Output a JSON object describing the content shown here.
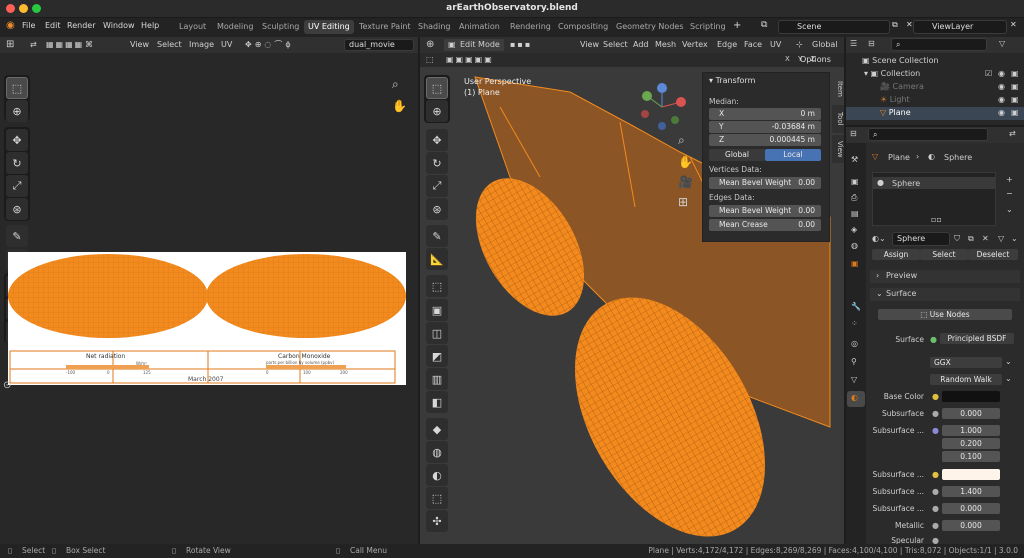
{
  "window": {
    "title": "arEarthObservatory.blend"
  },
  "menu": [
    "File",
    "Edit",
    "Render",
    "Window",
    "Help"
  ],
  "workspaces": [
    "Layout",
    "Modeling",
    "Sculpting",
    "UV Editing",
    "Texture Paint",
    "Shading",
    "Animation",
    "Rendering",
    "Compositing",
    "Geometry Nodes",
    "Scripting"
  ],
  "active_workspace": "UV Editing",
  "scene": "Scene",
  "view_layer": "ViewLayer",
  "uv_editor": {
    "menus": [
      "View",
      "Select",
      "Image",
      "UV"
    ],
    "image_name": "dual_movie",
    "texture_labels": {
      "left_title": "Net radiation",
      "right_title": "Carbon Monoxide",
      "right_subtitle": "parts per billion by volume (ppbv)",
      "left_units": "W/m²",
      "date": "March 2007",
      "left_ticks": [
        "-100",
        "0",
        "125"
      ],
      "right_ticks": [
        "0",
        "100",
        "200"
      ]
    }
  },
  "viewport": {
    "mode": "Edit Mode",
    "menus": [
      "View",
      "Select",
      "Add",
      "Mesh",
      "Vertex",
      "Edge",
      "Face",
      "UV"
    ],
    "orientation": "Global",
    "overlay_label": "User Perspective",
    "object_label": "(1) Plane",
    "options": "Options",
    "side_tabs": [
      "Item",
      "Tool",
      "View"
    ]
  },
  "transform_panel": {
    "title": "Transform",
    "median_label": "Median:",
    "x_label": "X",
    "x_value": "0 m",
    "y_label": "Y",
    "y_value": "-0.03684 m",
    "z_label": "Z",
    "z_value": "0.000445 m",
    "global": "Global",
    "local": "Local",
    "vertices_data": "Vertices Data:",
    "mean_bevel_weight": "Mean Bevel Weight",
    "mbw_v": "0.00",
    "edges_data": "Edges Data:",
    "mean_bevel_weight_e": "Mean Bevel Weight",
    "mbw_e": "0.00",
    "mean_crease": "Mean Crease",
    "mc": "0.00"
  },
  "outliner": {
    "root": "Scene Collection",
    "collection": "Collection",
    "items": [
      "Camera",
      "Light",
      "Plane"
    ]
  },
  "properties": {
    "object": "Plane",
    "material": "Sphere",
    "slot": "Sphere",
    "mat_field": "Sphere",
    "assign": "Assign",
    "select": "Select",
    "deselect": "Deselect",
    "preview": "Preview",
    "surface_section": "Surface",
    "use_nodes": "Use Nodes",
    "surface_label": "Surface",
    "surface_value": "Principled BSDF",
    "distribution": "GGX",
    "subsurface_method": "Random Walk",
    "base_color": "Base Color",
    "subsurface": "Subsurface",
    "subsurface_v": "0.000",
    "subsurface_radius": "Subsurface ...",
    "radius": [
      "1.000",
      "0.200",
      "0.100"
    ],
    "subsurface_color": "Subsurface ...",
    "subsurface_ior": "Subsurface ...",
    "ior_v": "1.400",
    "subsurface_aniso": "Subsurface ...",
    "aniso_v": "0.000",
    "metallic": "Metallic",
    "metallic_v": "0.000",
    "specular": "Specular"
  },
  "status": {
    "select": "Select",
    "box_select": "Box Select",
    "rotate_view": "Rotate View",
    "call_menu": "Call Menu",
    "stats": "Plane | Verts:4,172/4,172 | Edges:8,269/8,269 | Faces:4,100/4,100 | Tris:8,072 | Objects:1/1 | 3.0.0"
  },
  "colors": {
    "accent": "#f28a1e",
    "selection": "#ff8c1a",
    "bg": "#1d1d1d"
  }
}
